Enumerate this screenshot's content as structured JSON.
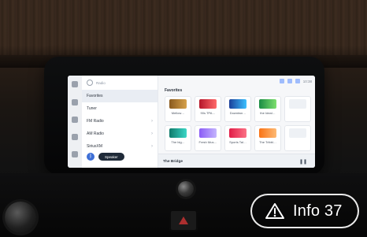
{
  "screen": {
    "sidebar": {
      "header": "Radio",
      "menu": [
        {
          "label": "Favorites"
        },
        {
          "label": "Tuner"
        },
        {
          "label": "FM Radio"
        },
        {
          "label": "AM Radio"
        },
        {
          "label": "SiriusXM"
        }
      ],
      "bottom_button": "Speaker"
    },
    "status": {
      "time": "10:38"
    },
    "main": {
      "section_title": "Favorites",
      "cards": [
        {
          "label": "Mellow…"
        },
        {
          "label": "90s TPA…"
        },
        {
          "label": "Downtwn…"
        },
        {
          "label": "the Ideal…"
        },
        {
          "label": ""
        },
        {
          "label": "The big…"
        },
        {
          "label": "Fresh Mus…"
        },
        {
          "label": "Sports Tal…"
        },
        {
          "label": "The Tribbl…"
        },
        {
          "label": ""
        }
      ],
      "now_playing": "The Bridge"
    }
  },
  "overlay": {
    "info_label": "Info 37"
  },
  "colors": {
    "accent_blue": "#3e6fd6",
    "hazard_red": "#c73434"
  },
  "icons": {
    "warning": "warning-triangle-icon",
    "pause": "pause-icon"
  }
}
